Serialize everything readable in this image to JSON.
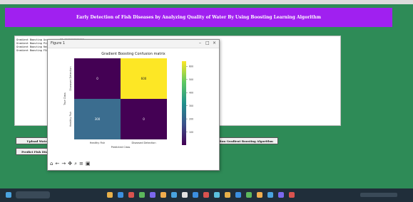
{
  "app": {
    "title": "Early Detection of Fish Diseases by Analyzing Quality of Water By Using Boosting Learning Algorithm"
  },
  "output_lines": [
    "Gradient Boosting Accuracy : 98.0000000000000",
    "Gradient Boosting Precision : ...",
    "Gradient Boosting Recall : ...",
    "Gradient Boosting FScore : ..."
  ],
  "buttons": {
    "upload": "Upload Water Dataset",
    "run_gb": "Run Gradient Boosting Algorithm",
    "predict": "Predict Fish Disease"
  },
  "figure_window": {
    "title": "Figure 1",
    "toolbar_icons": [
      "home-icon",
      "back-icon",
      "forward-icon",
      "pan-icon",
      "zoom-icon",
      "configure-icon",
      "save-icon"
    ]
  },
  "chart_data": {
    "type": "heatmap",
    "title": "Gradient Boosting Confusion matrix",
    "xlabel": "Predicted Class",
    "ylabel": "True Class",
    "x_categories": [
      "Healthy Fish",
      "Diseased Detection"
    ],
    "y_categories": [
      "Diseased Detection",
      "Healthy Fish"
    ],
    "values": [
      [
        0,
        600
      ],
      [
        300,
        0
      ]
    ],
    "cell_labels": [
      [
        "0",
        "600"
      ],
      [
        "300",
        "0"
      ]
    ],
    "colorbar_ticks": [
      100,
      200,
      300,
      400,
      500,
      600
    ],
    "colormap": [
      "#440154",
      "#3b528b",
      "#21918c",
      "#5ec962",
      "#fde725"
    ],
    "cell_colors": [
      [
        "#440154",
        "#fde725"
      ],
      [
        "#3b6d8f",
        "#440154"
      ]
    ]
  },
  "colors": {
    "background": "#2e8b57",
    "banner": "#a020f0",
    "taskbar": "#202e3a"
  }
}
